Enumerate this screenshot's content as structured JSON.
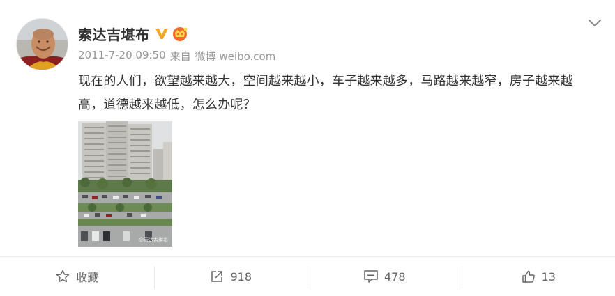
{
  "post": {
    "author": "索达吉堪布",
    "timestamp": "2011-7-20 09:50",
    "via": "来自",
    "source": "微博 weibo.com",
    "content": "现在的人们，欲望越来越大，空间越来越小，车子越来越多，马路越来越窄，房子越来越高，道德越来越低，怎么办呢？",
    "photo_watermark": "@索达吉堪布"
  },
  "actions": {
    "favorite_label": "收藏",
    "repost_count": "918",
    "comment_count": "478",
    "like_count": "13"
  },
  "icons": {
    "avatar": "avatar",
    "verified": "verified-v-icon",
    "member": "member-crown-icon",
    "more": "chevron-down-icon",
    "favorite": "star-icon",
    "repost": "share-arrow-icon",
    "comment": "comment-icon",
    "like": "thumbs-up-icon"
  },
  "colors": {
    "verified": "#F5A623",
    "member": "#F26A2A",
    "text": "#333333",
    "meta": "#939393",
    "action": "#636363"
  }
}
